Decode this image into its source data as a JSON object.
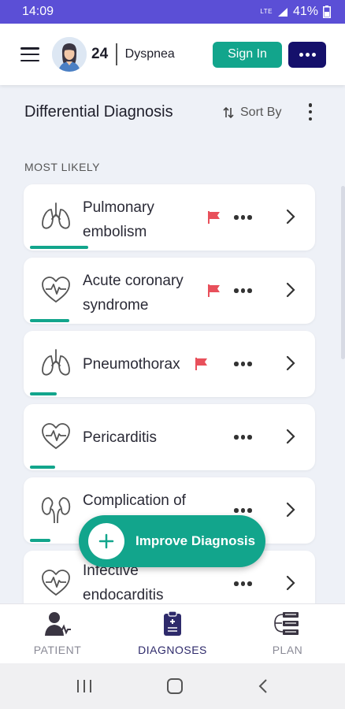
{
  "status": {
    "time": "14:09",
    "network": "LTE",
    "battery": "41%"
  },
  "header": {
    "age": "24",
    "complaint": "Dyspnea",
    "signin_label": "Sign In"
  },
  "section": {
    "title": "Differential Diagnosis",
    "sort_label": "Sort By",
    "group_label": "MOST LIKELY"
  },
  "diagnoses": [
    {
      "line1": "Pulmonary",
      "line2": "embolism",
      "flagged": true,
      "icon": "lungs-icon",
      "likelihood": 0.2
    },
    {
      "line1": "Acute coronary",
      "line2": "syndrome",
      "flagged": true,
      "icon": "heart-pulse-icon",
      "likelihood": 0.14
    },
    {
      "line1": "Pneumothorax",
      "line2": "",
      "flagged": true,
      "icon": "lungs-icon",
      "likelihood": 0.1
    },
    {
      "line1": "Pericarditis",
      "line2": "",
      "flagged": false,
      "icon": "heart-pulse-icon",
      "likelihood": 0.09
    },
    {
      "line1": "Complication of",
      "line2": "",
      "flagged": false,
      "icon": "kidneys-icon",
      "likelihood": 0.07
    },
    {
      "line1": "Infective",
      "line2": "endocarditis",
      "flagged": false,
      "icon": "heart-pulse-icon",
      "likelihood": 0.0
    }
  ],
  "fab": {
    "label": "Improve Diagnosis"
  },
  "nav": {
    "patient": "PATIENT",
    "diagnoses": "DIAGNOSES",
    "plan": "PLAN"
  },
  "colors": {
    "accent": "#12a58c",
    "status_bar": "#5b4fd6",
    "primary_dark": "#15106b",
    "flag": "#e8505b"
  }
}
